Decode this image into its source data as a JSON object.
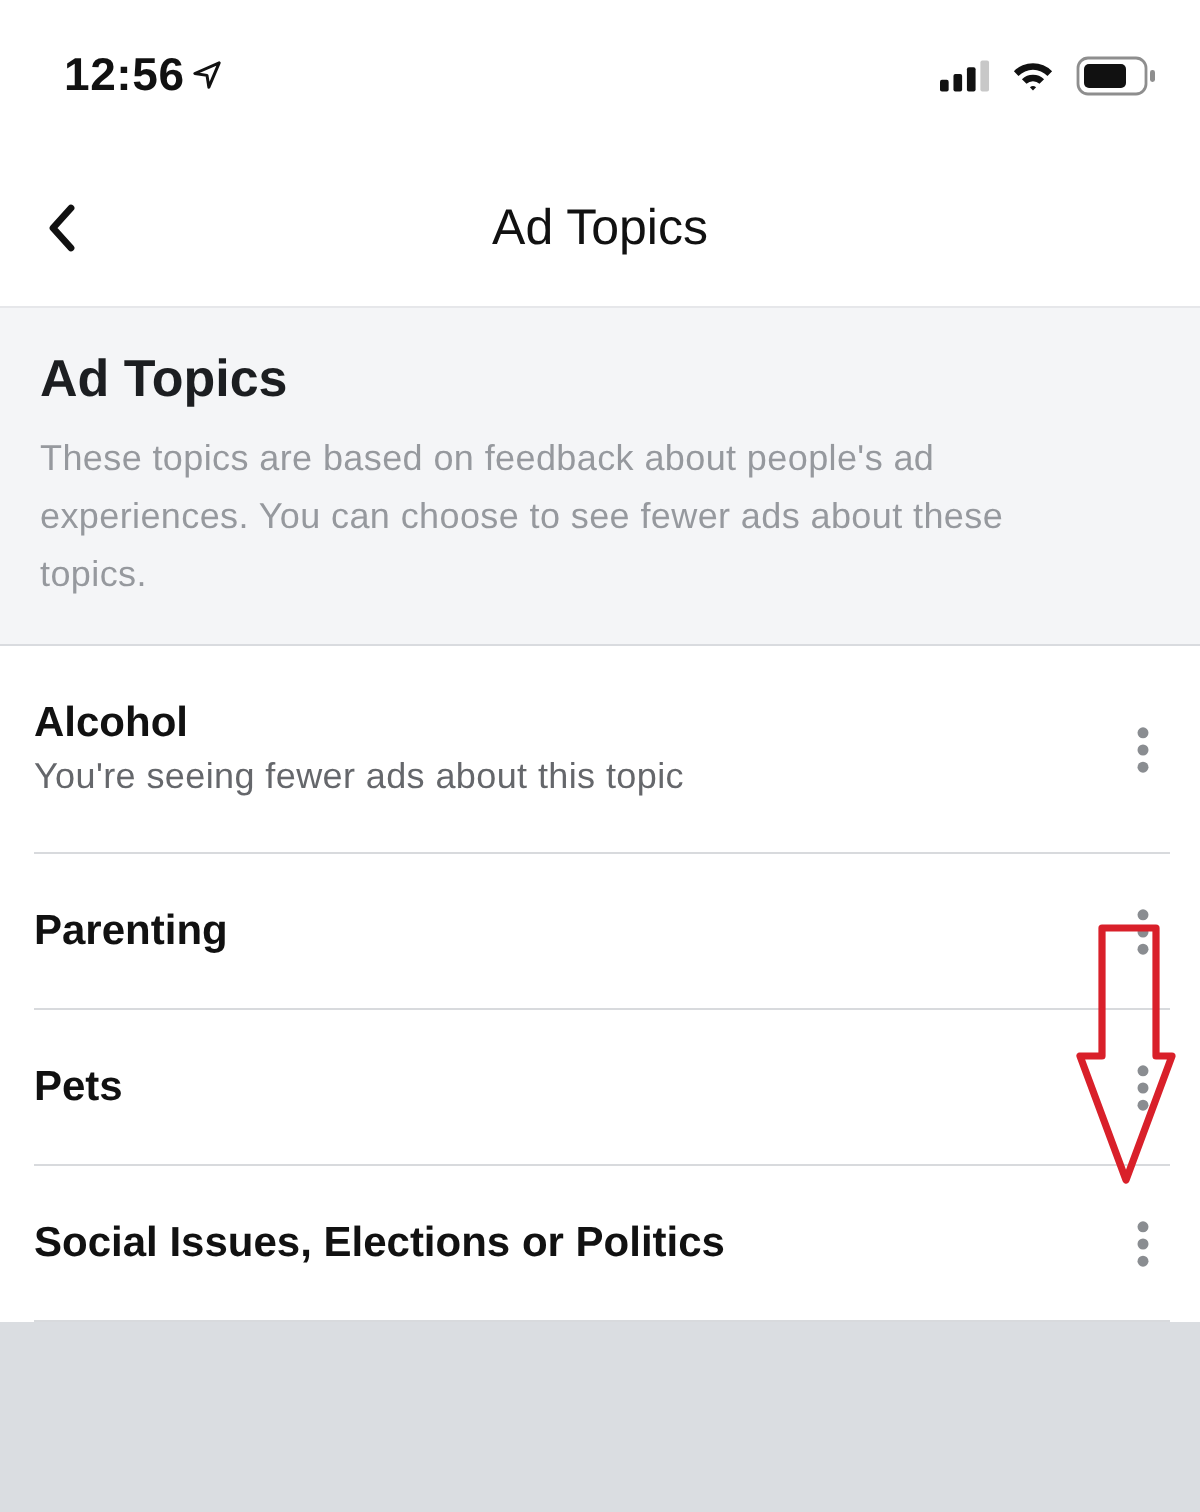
{
  "status_bar": {
    "time": "12:56"
  },
  "nav_bar": {
    "title": "Ad Topics"
  },
  "header": {
    "title": "Ad Topics",
    "description": "These topics are based on feedback about people's ad experiences. You can choose to see fewer ads about these topics."
  },
  "topics": [
    {
      "name": "Alcohol",
      "status": "You're seeing fewer ads about this topic"
    },
    {
      "name": "Parenting"
    },
    {
      "name": "Pets"
    },
    {
      "name": "Social Issues, Elections or Politics"
    }
  ],
  "annotation": {
    "kind": "arrow"
  }
}
